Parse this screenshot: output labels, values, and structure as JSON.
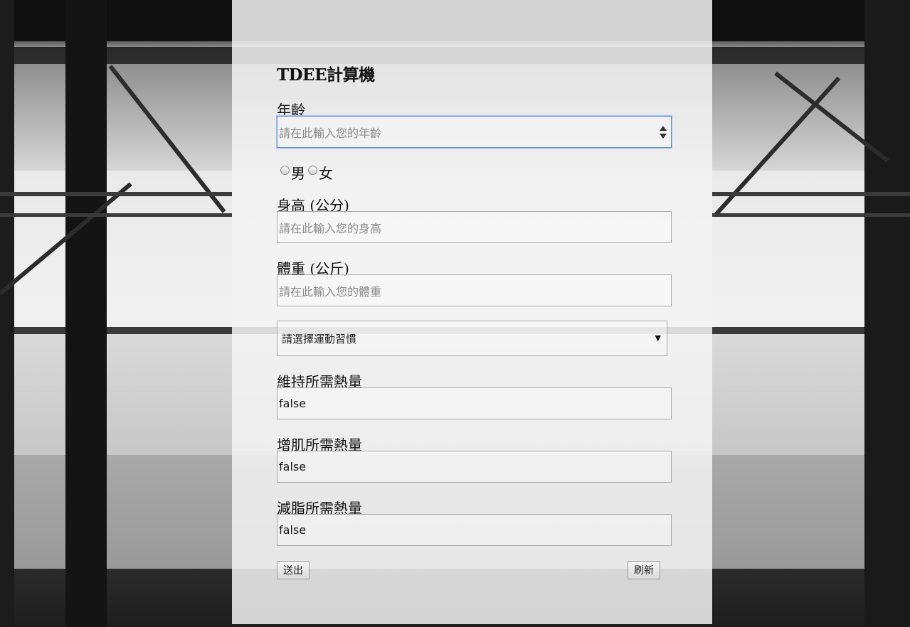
{
  "form": {
    "title": "TDEE計算機",
    "age": {
      "label": "年齡",
      "placeholder": "請在此輸入您的年齡"
    },
    "gender": {
      "options": [
        "男",
        "女"
      ]
    },
    "height": {
      "label": "身高 (公分)",
      "placeholder": "請在此輸入您的身高"
    },
    "weight": {
      "label": "體重 (公斤)",
      "placeholder": "請在此輸入您的體重"
    },
    "activity": {
      "selected": "請選擇運動習慣"
    },
    "maintain": {
      "label": "維持所需熱量",
      "value": "false"
    },
    "bulk": {
      "label": "增肌所需熱量",
      "value": "false"
    },
    "cut": {
      "label": "減脂所需熱量",
      "value": "false"
    },
    "submit_label": "送出",
    "refresh_label": "刷新"
  },
  "colors": {
    "focus_border": "#5b8fdc",
    "panel": "#f3f3f3"
  }
}
